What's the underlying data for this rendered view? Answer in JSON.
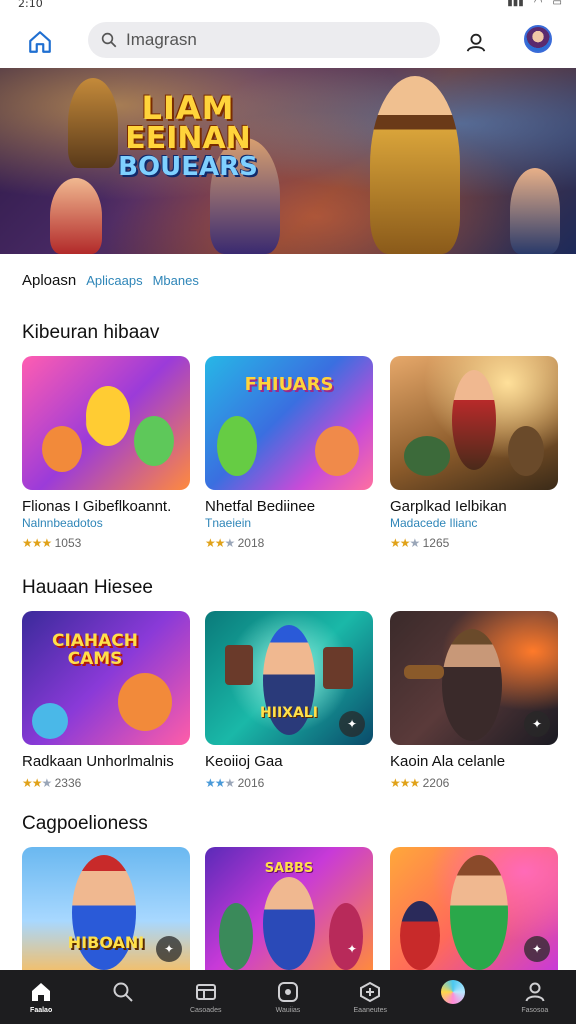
{
  "status_bar": {
    "time": "2:10"
  },
  "search": {
    "placeholder": "Imagrasn"
  },
  "hero": {
    "title_line1": "LIAM",
    "title_line2": "EEINAN",
    "title_line3": "BOUEARS"
  },
  "tabs": {
    "active": "Aploasn",
    "items": [
      "Aplicaaps",
      "Mbanes"
    ]
  },
  "sections": [
    {
      "title": "Kibeuran hibaav",
      "cards": [
        {
          "title": "Flionas I Gibeflkoannt.",
          "subtitle": "Nalnnbeadotos",
          "rating": "1053",
          "stars": 3,
          "label": ""
        },
        {
          "title": "Nhetfal Bediinee",
          "subtitle": "Tnaeiein",
          "rating": "2018",
          "stars": 2,
          "label": "FHIUARS"
        },
        {
          "title": "Garplkad Ielbikan",
          "subtitle": "Madacede Ilianc",
          "rating": "1265",
          "stars": 2,
          "label": ""
        }
      ]
    },
    {
      "title": "Hauaan Hiesee",
      "cards": [
        {
          "title": "Radkaan Unhorlmalnis",
          "subtitle": "",
          "rating": "2336",
          "stars": 2,
          "label": "CIAHACH CAMS"
        },
        {
          "title": "Keoiioj Gaa",
          "subtitle": "",
          "rating": "2016",
          "stars": 2,
          "label": "HIIXALI"
        },
        {
          "title": "Kaoin Ala celanle",
          "subtitle": "",
          "rating": "2206",
          "stars": 3,
          "label": ""
        }
      ]
    },
    {
      "title": "Cagpoelioness",
      "cards": [
        {
          "label": "HIBOANI"
        },
        {
          "label": "SABBS"
        },
        {
          "label": ""
        }
      ]
    }
  ],
  "bottom_nav": [
    {
      "label": "Faalao",
      "icon": "home-icon"
    },
    {
      "label": "",
      "icon": "search-icon"
    },
    {
      "label": "Casoades",
      "icon": "games-icon"
    },
    {
      "label": "Wauiias",
      "icon": "play-icon"
    },
    {
      "label": "Eaaneutes",
      "icon": "library-icon"
    },
    {
      "label": "",
      "icon": "assistant-icon"
    },
    {
      "label": "Fasosoa",
      "icon": "profile-icon"
    }
  ],
  "colors": {
    "accent": "#2f86b8",
    "nav_bg": "#1d1d1f",
    "star": "#e0a21a"
  }
}
